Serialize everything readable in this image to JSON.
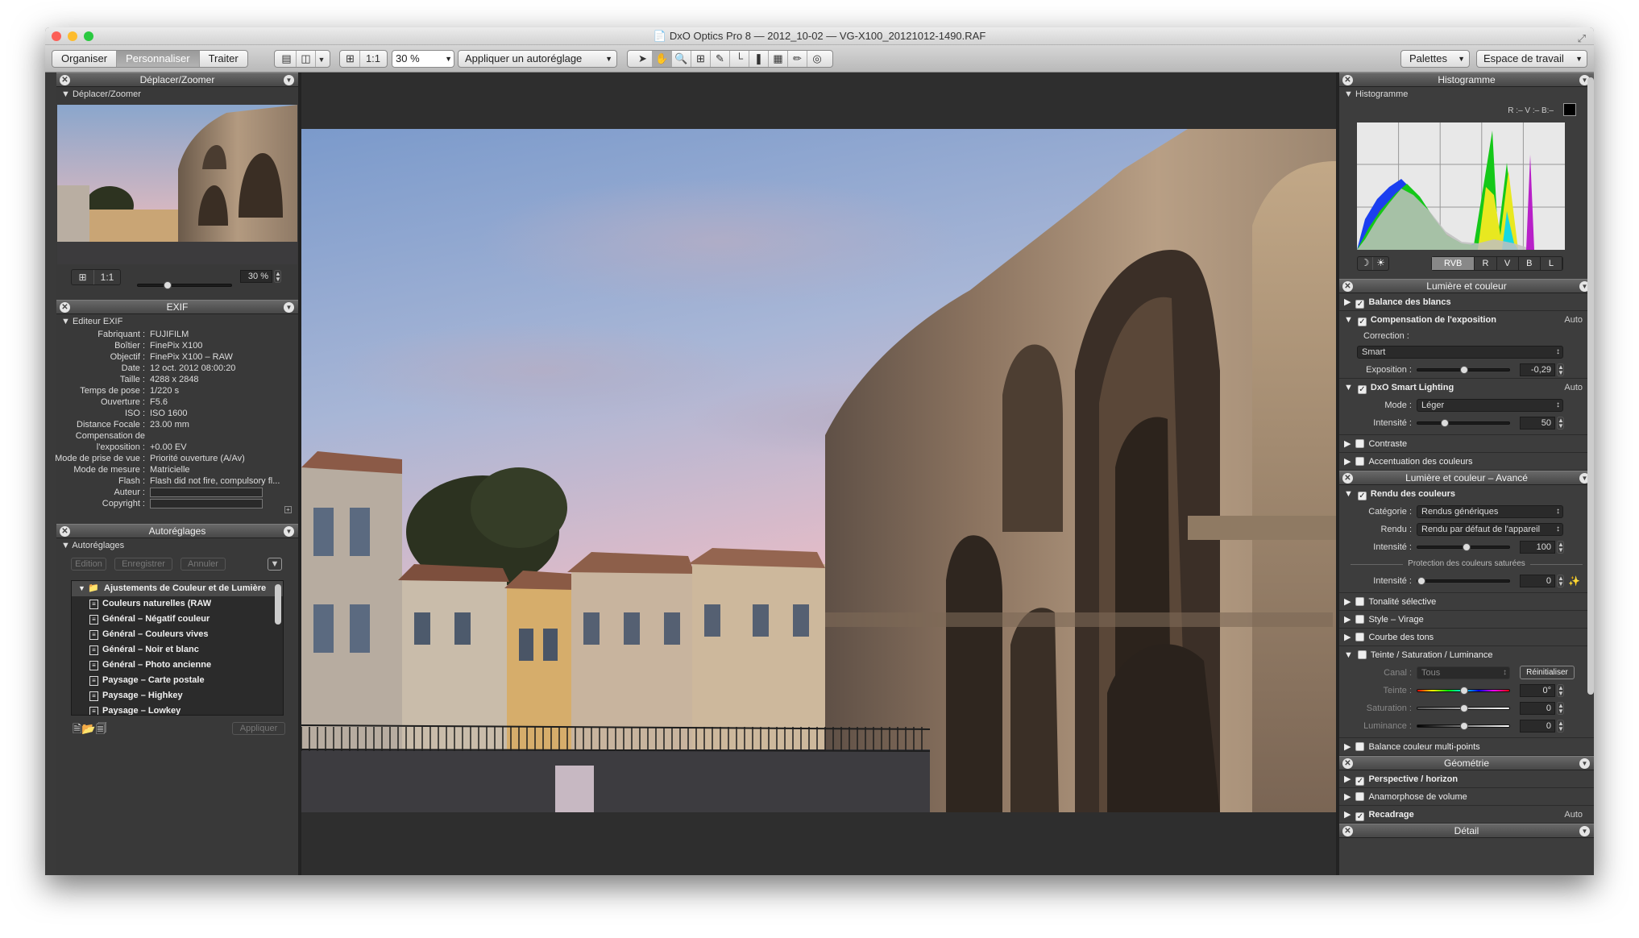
{
  "window": {
    "title": "DxO Optics Pro 8 — 2012_10-02 — VG-X100_20121012-1490.RAF"
  },
  "toolbar": {
    "tabs": [
      {
        "label": "Organiser"
      },
      {
        "label": "Personnaliser"
      },
      {
        "label": "Traiter"
      }
    ],
    "zoom_1to1": "1:1",
    "zoom_value": "30 %",
    "preset_dropdown": "Appliquer un autoréglage",
    "palettes": "Palettes",
    "workspace": "Espace de travail"
  },
  "left": {
    "move_zoom": {
      "title": "Déplacer/Zoomer",
      "sub": "Déplacer/Zoomer",
      "one_to_one": "1:1",
      "zoom": "30 %",
      "slider_fraction": 0.3
    },
    "exif": {
      "title": "EXIF",
      "sub": "Editeur EXIF",
      "rows": [
        {
          "k": "Fabriquant :",
          "v": "FUJIFILM"
        },
        {
          "k": "Boîtier :",
          "v": "FinePix X100"
        },
        {
          "k": "Objectif :",
          "v": "FinePix X100 – RAW"
        },
        {
          "k": "Date :",
          "v": "12 oct. 2012 08:00:20"
        },
        {
          "k": "Taille :",
          "v": "4288 x 2848"
        },
        {
          "k": "Temps de pose :",
          "v": "1/220 s"
        },
        {
          "k": "Ouverture :",
          "v": "F5.6"
        },
        {
          "k": "ISO :",
          "v": "ISO 1600"
        },
        {
          "k": "Distance Focale :",
          "v": "23.00 mm"
        },
        {
          "k": "Compensation de",
          "v": ""
        },
        {
          "k": "l'exposition :",
          "v": "+0.00 EV"
        },
        {
          "k": "Mode de prise de vue :",
          "v": "Priorité ouverture (A/Av)"
        },
        {
          "k": "Mode de mesure :",
          "v": "Matricielle"
        },
        {
          "k": "Flash :",
          "v": "Flash did not fire, compulsory fl..."
        },
        {
          "k": "Auteur :",
          "v": ""
        },
        {
          "k": "Copyright :",
          "v": ""
        }
      ]
    },
    "presets": {
      "title": "Autoréglages",
      "sub": "Autoréglages",
      "edit": "Edition",
      "save": "Enregistrer",
      "cancel": "Annuler",
      "apply": "Appliquer",
      "folder": "Ajustements de Couleur et de Lumière",
      "items": [
        "Couleurs naturelles (RAW",
        "Général – Négatif couleur",
        "Général – Couleurs vives",
        "Général – Noir et blanc",
        "Général – Photo ancienne",
        "Paysage – Carte postale",
        "Paysage – Highkey",
        "Paysage – Lowkey"
      ]
    }
  },
  "right": {
    "histogram": {
      "title": "Histogramme",
      "sub": "Histogramme",
      "readout": "R :–  V :–  B:–",
      "channels": [
        "RVB",
        "R",
        "V",
        "B",
        "L"
      ]
    },
    "light": {
      "title": "Lumière et couleur",
      "wb": "Balance des blancs",
      "exposure": {
        "label": "Compensation de l'exposition",
        "auto": "Auto",
        "correction_label": "Correction :",
        "correction": "Smart",
        "exposure_label": "Exposition :",
        "value": "-0,29"
      },
      "smart_lighting": {
        "label": "DxO Smart Lighting",
        "auto": "Auto",
        "mode_label": "Mode :",
        "mode": "Léger",
        "intensity_label": "Intensité :",
        "value": "50"
      },
      "contrast": "Contraste",
      "vibrancy": "Accentuation des couleurs"
    },
    "advanced": {
      "title": "Lumière et couleur – Avancé",
      "rendering": {
        "label": "Rendu des couleurs",
        "category_label": "Catégorie :",
        "category": "Rendus génériques",
        "render_label": "Rendu :",
        "render": "Rendu par défaut de l'appareil",
        "intensity_label": "Intensité :",
        "value": "100",
        "protection": "Protection des couleurs saturées",
        "intensity2_label": "Intensité :",
        "value2": "0"
      },
      "tone": "Tonalité sélective",
      "style": "Style – Virage",
      "curve": "Courbe des tons",
      "hsl": {
        "label": "Teinte / Saturation / Luminance",
        "channel_label": "Canal :",
        "channel": "Tous",
        "reset": "Réinitialiser",
        "hue_label": "Teinte :",
        "hue": "0°",
        "sat_label": "Saturation :",
        "sat": "0",
        "lum_label": "Luminance :",
        "lum": "0"
      },
      "multipoint": "Balance couleur multi-points"
    },
    "geometry": {
      "title": "Géométrie",
      "perspective": "Perspective / horizon",
      "anamorphosis": "Anamorphose de volume",
      "crop": "Recadrage",
      "crop_auto": "Auto"
    },
    "detail": {
      "title": "Détail"
    }
  },
  "colors": {
    "accent_selected": "#a6a6a6",
    "panel_bg": "#3a3a3a"
  }
}
